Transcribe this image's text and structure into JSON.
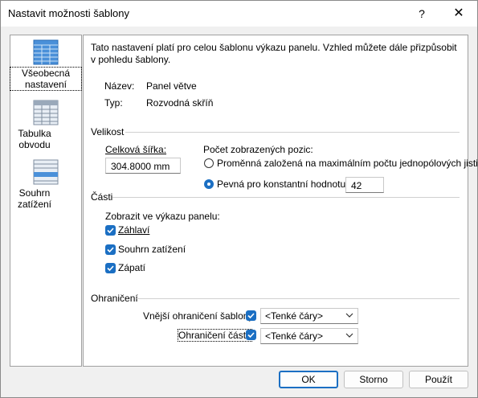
{
  "window": {
    "title": "Nastavit možnosti šablony",
    "help": "?",
    "close": "✕"
  },
  "sidebar": {
    "items": [
      {
        "label": "Všeobecná nastavení",
        "icon": "grid-table-icon",
        "selected": true
      },
      {
        "label": "Tabulka obvodu",
        "icon": "grid-table-icon",
        "selected": false
      },
      {
        "label": "Souhrn zatížení",
        "icon": "grid-table-icon",
        "selected": false
      }
    ]
  },
  "main": {
    "intro": "Tato nastavení platí pro celou šablonu výkazu panelu. Vzhled můžete dále přizpůsobit v pohledu šablony.",
    "name_label": "Název:",
    "name_value": "Panel větve",
    "type_label": "Typ:",
    "type_value": "Rozvodná skříň",
    "size": {
      "group": "Velikost",
      "total_width_label": "Celková šířka:",
      "total_width_value": "304.8000 mm",
      "positions_label": "Počet zobrazených pozic:",
      "option_variable": "Proměnná založená na maximálním počtu jednopólových jističů",
      "option_fixed": "Pevná pro konstantní hodnotu:",
      "fixed_value": "42"
    },
    "parts": {
      "group": "Části",
      "show_label": "Zobrazit ve výkazu panelu:",
      "header": "Záhlaví",
      "load_summary": "Souhrn zatížení",
      "footer": "Zápatí"
    },
    "borders": {
      "group": "Ohraničení",
      "outer_label": "Vnější ohraničení šablony:",
      "outer_value": "<Tenké čáry>",
      "sections_label": "Ohraničení částí:",
      "sections_value": "<Tenké čáry>"
    }
  },
  "footer": {
    "ok": "OK",
    "cancel": "Storno",
    "apply": "Použít"
  },
  "colors": {
    "accent": "#1b6fc3",
    "panel_bg": "#ffffff",
    "window_bg": "#f0f0f0"
  }
}
